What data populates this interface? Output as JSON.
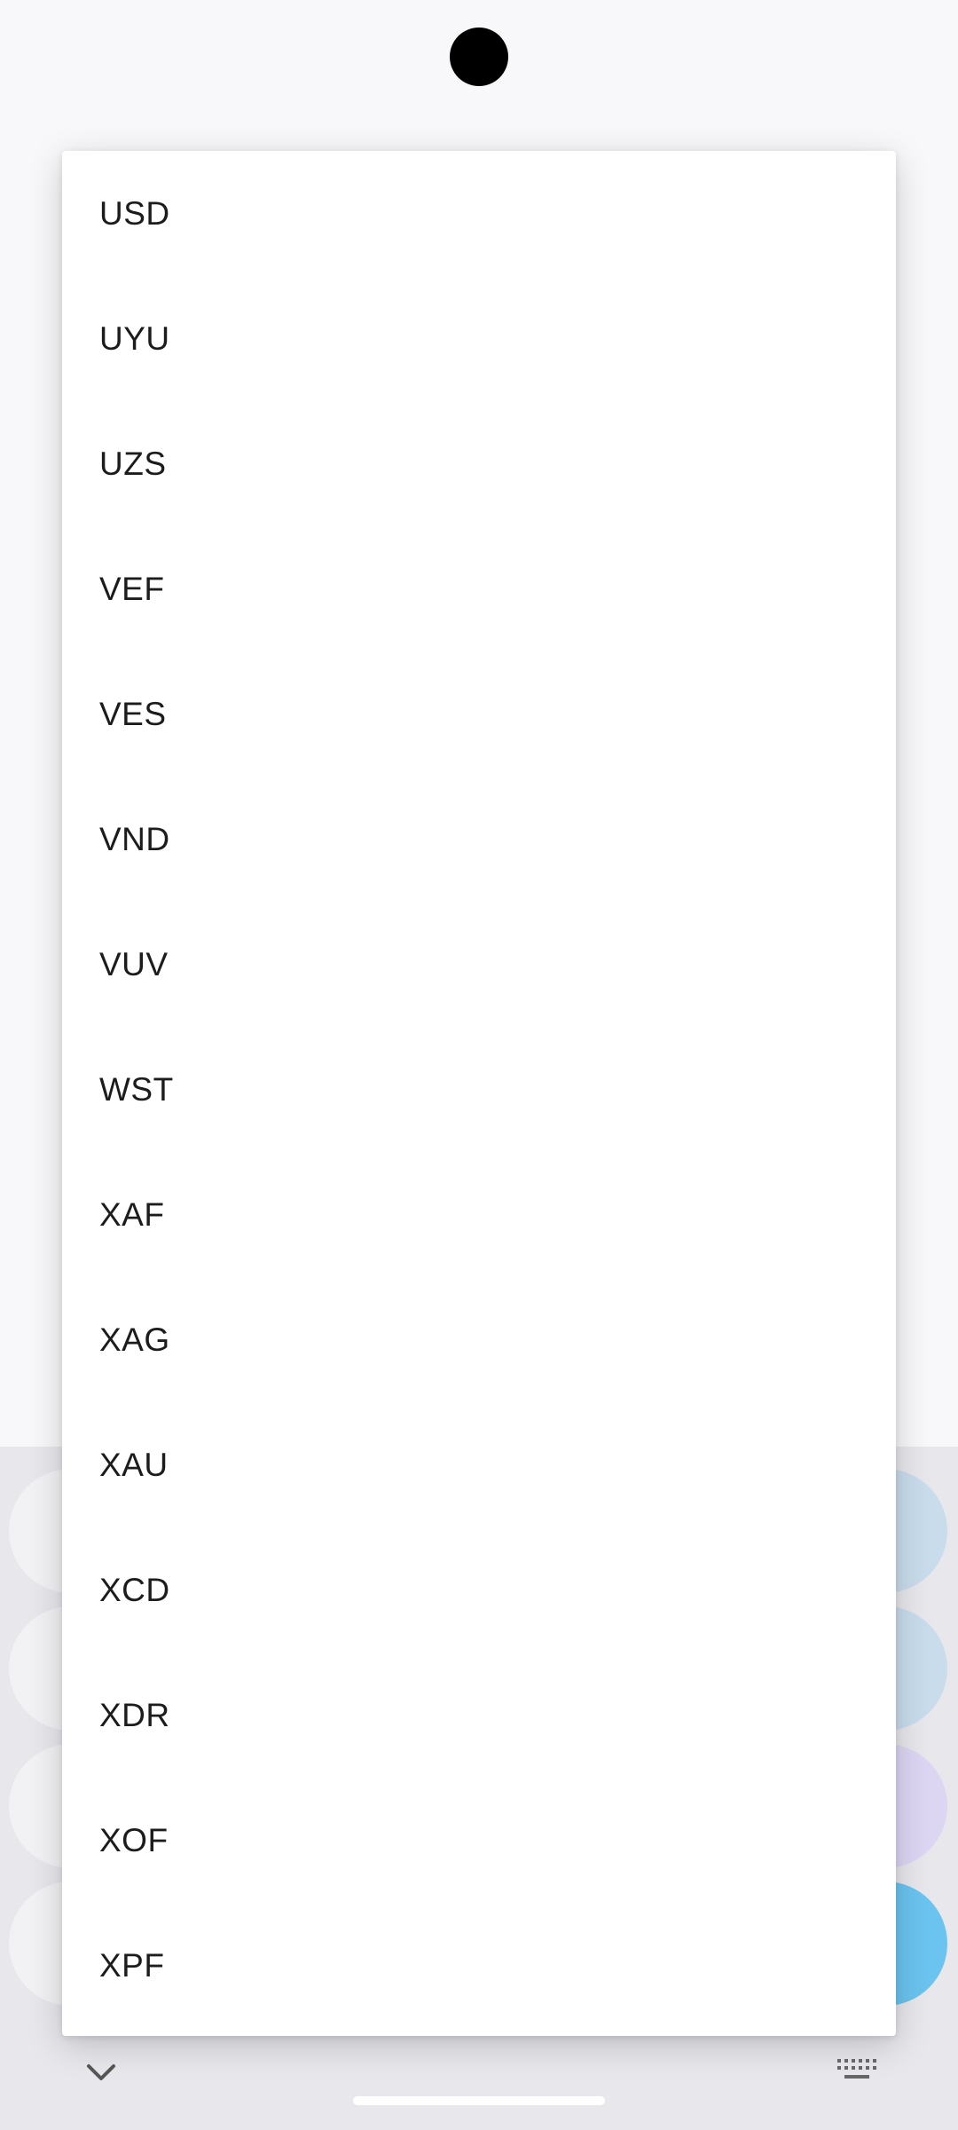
{
  "dropdown": {
    "items": [
      {
        "label": "USD"
      },
      {
        "label": "UYU"
      },
      {
        "label": "UZS"
      },
      {
        "label": "VEF"
      },
      {
        "label": "VES"
      },
      {
        "label": "VND"
      },
      {
        "label": "VUV"
      },
      {
        "label": "WST"
      },
      {
        "label": "XAF"
      },
      {
        "label": "XAG"
      },
      {
        "label": "XAU"
      },
      {
        "label": "XCD"
      },
      {
        "label": "XDR"
      },
      {
        "label": "XOF"
      },
      {
        "label": "XPF"
      }
    ]
  },
  "navigation": {
    "left_icon": "chevron-down-icon",
    "right_icon": "keyboard-icon"
  },
  "colors": {
    "menu_background": "#ffffff",
    "text": "#1c1c1e",
    "accent_button": "#6ac4ef"
  }
}
